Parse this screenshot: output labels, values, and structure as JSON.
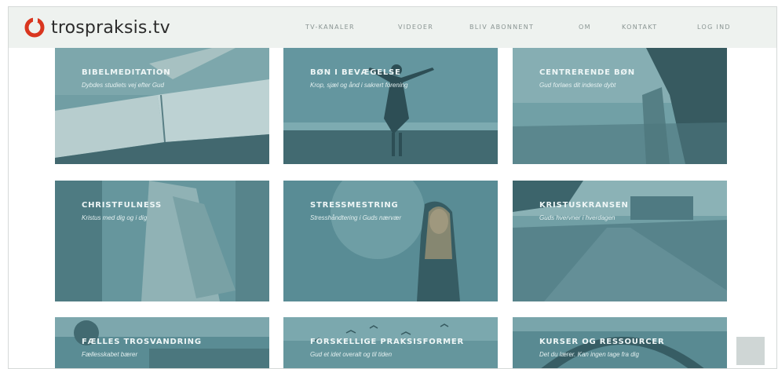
{
  "brand": {
    "name": "trospraksis.tv",
    "accent": "#d9361f"
  },
  "nav": [
    {
      "label": "TV-KANALER"
    },
    {
      "label": "VIDEOER"
    },
    {
      "label": "BLIV ABONNENT"
    },
    {
      "label": "OM"
    },
    {
      "label": "KONTAKT"
    },
    {
      "label": "LOG IND"
    }
  ],
  "tiles": [
    {
      "title": "BIBELMEDITATION",
      "subtitle": "Dybdes studiets vej efter Gud"
    },
    {
      "title": "BØN I BEVÆGELSE",
      "subtitle": "Krop, sjæl og ånd i sakrert forening"
    },
    {
      "title": "CENTRERENDE BØN",
      "subtitle": "Gud forlaes dit indeste dybt"
    },
    {
      "title": "CHRISTFULNESS",
      "subtitle": "Kristus med dig og i dig"
    },
    {
      "title": "STRESSMESTRING",
      "subtitle": "Stresshåndtering i Guds nærvær"
    },
    {
      "title": "KRISTUSKRANSEN",
      "subtitle": "Guds hvervner i hverdagen"
    },
    {
      "title": "FÆLLES TROSVANDRING",
      "subtitle": "Fællesskabet bærer"
    },
    {
      "title": "FORSKELLIGE PRAKSISFORMER",
      "subtitle": "Gud et idet overalt og til tiden"
    },
    {
      "title": "KURSER OG RESSOURCER",
      "subtitle": "Det du lærer. Kan ingen tage fra dig"
    }
  ]
}
